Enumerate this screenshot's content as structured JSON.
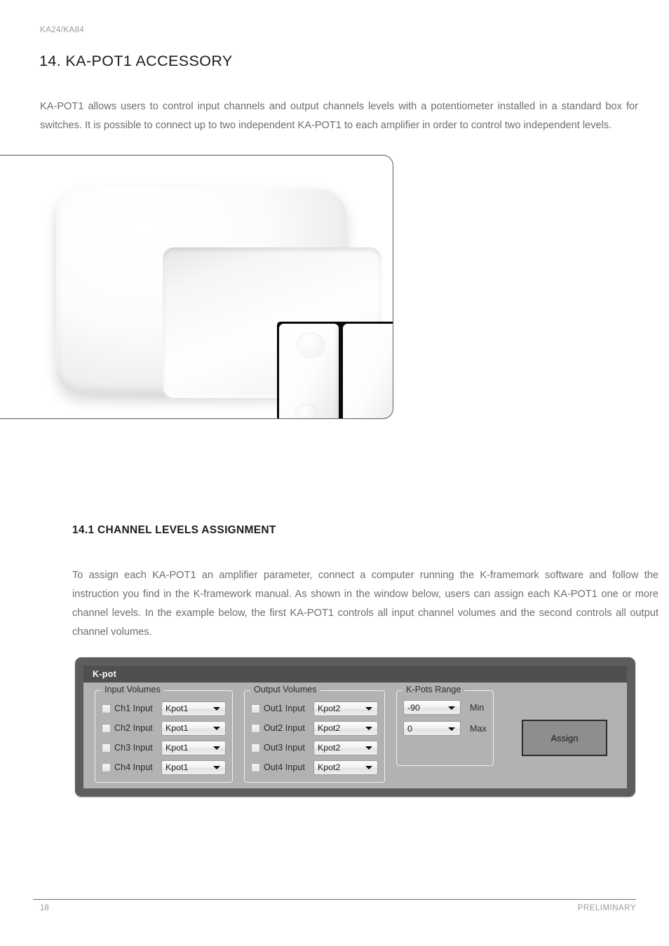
{
  "header": {
    "doc_ref": "KA24/KA84",
    "title": "14. KA-POT1 ACCESSORY"
  },
  "intro": {
    "paragraph": "KA-POT1 allows users to control input channels and output channels levels with a potentiometer installed in a standard box for switches. It is possible to connect up to two independent KA-POT1 to each amplifier in order to control two independent levels."
  },
  "figure": {
    "caption": ""
  },
  "section": {
    "title": "14.1 CHANNEL LEVELS ASSIGNMENT",
    "paragraph": "To assign each KA-POT1 an amplifier parameter, connect a computer running the K-framemork software and follow the instruction you find in the K-framework manual. As shown in the window below, users can assign each KA-POT1 one or more channel levels. In the example below, the first KA-POT1 controls all input channel volumes and the second controls all output channel volumes."
  },
  "kpot_dialog": {
    "title": "K-pot",
    "input_group": {
      "legend": "Input Volumes",
      "rows": [
        {
          "label": "Ch1 Input",
          "value": "Kpot1",
          "checked": false
        },
        {
          "label": "Ch2 Input",
          "value": "Kpot1",
          "checked": false
        },
        {
          "label": "Ch3 Input",
          "value": "Kpot1",
          "checked": false
        },
        {
          "label": "Ch4 Input",
          "value": "Kpot1",
          "checked": false
        }
      ]
    },
    "output_group": {
      "legend": "Output Volumes",
      "rows": [
        {
          "label": "Out1 Input",
          "value": "Kpot2",
          "checked": false
        },
        {
          "label": "Out2 Input",
          "value": "Kpot2",
          "checked": false
        },
        {
          "label": "Out3 Input",
          "value": "Kpot2",
          "checked": false
        },
        {
          "label": "Out4 Input",
          "value": "Kpot2",
          "checked": false
        }
      ]
    },
    "range_group": {
      "legend": "K-Pots Range",
      "min": {
        "value": "-90",
        "label": "Min"
      },
      "max": {
        "value": "0",
        "label": "Max"
      }
    },
    "assign_button": "Assign",
    "colors": {
      "window_frame": "#5d5d5d",
      "titlebar": "#4f4f4f",
      "body": "#b2b2b2",
      "button": "#8e8e8e"
    }
  },
  "footer": {
    "page_number": "18",
    "status": "PRELIMINARY"
  }
}
